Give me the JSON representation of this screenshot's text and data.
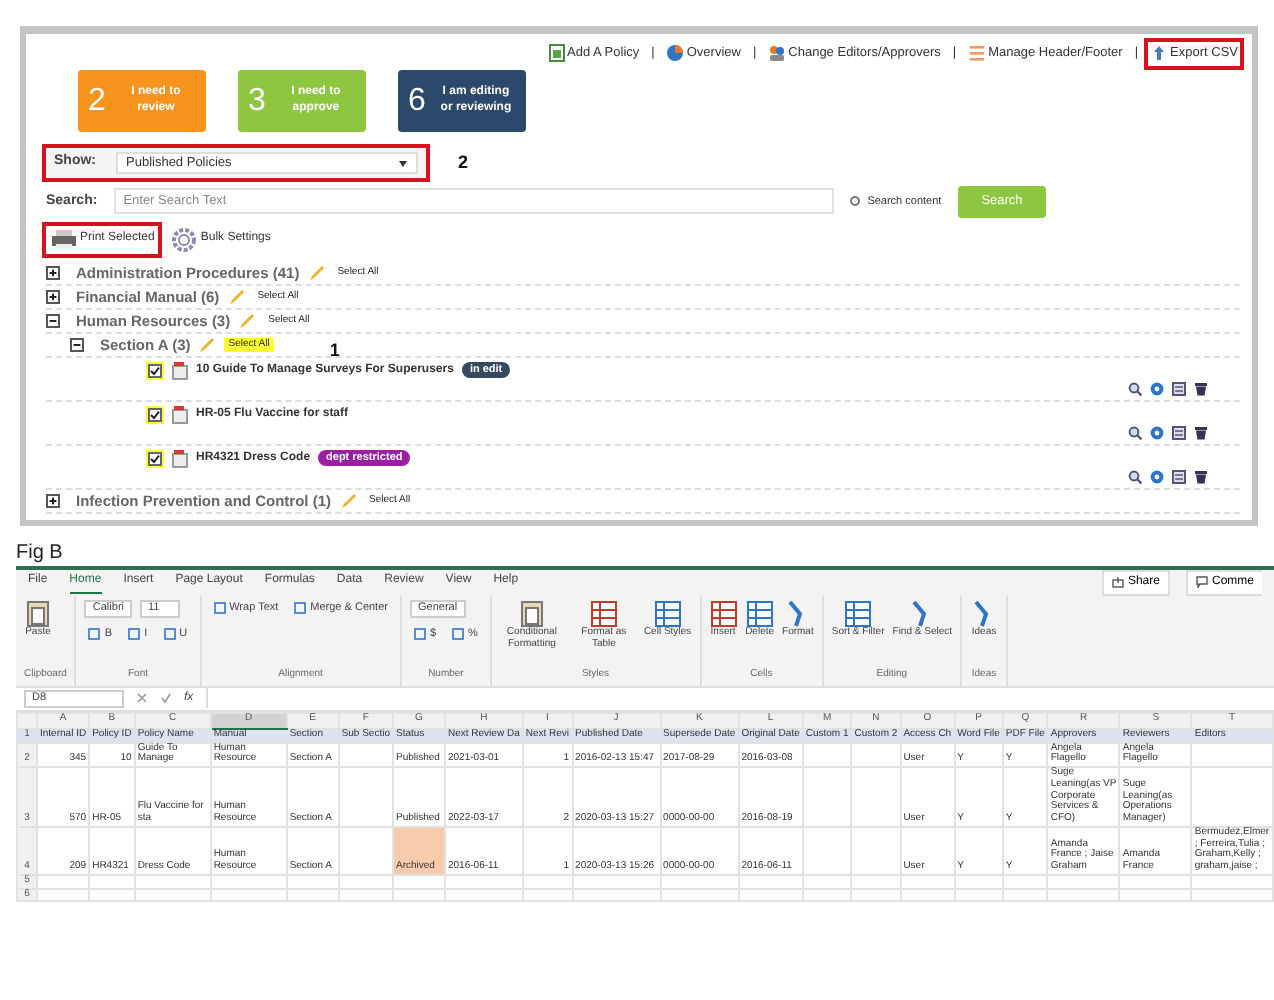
{
  "panel_a": {
    "tiles": [
      {
        "count": "2",
        "label": "I need to review",
        "color": "#f7941d"
      },
      {
        "count": "3",
        "label": "I need to approve",
        "color": "#8dc63f"
      },
      {
        "count": "6",
        "label": "I am editing or reviewing",
        "color": "#2b4a6b"
      }
    ],
    "top_links": [
      {
        "kind": "add",
        "label": "Add A Policy",
        "separator": "|",
        "highlighted": false
      },
      {
        "kind": "overview",
        "label": "Overview",
        "separator": "|",
        "highlighted": false
      },
      {
        "kind": "editors",
        "label": "Change Editors/Approvers",
        "separator": "|",
        "highlighted": false
      },
      {
        "kind": "header",
        "label": "Manage Header/Footer",
        "separator": "|",
        "highlighted": false
      },
      {
        "kind": "export",
        "label": "Export CSV",
        "highlighted": true
      }
    ],
    "show": {
      "label": "Show:",
      "value": "Published Policies",
      "highlighted": true,
      "callout": "2"
    },
    "search": {
      "label": "Search:",
      "placeholder": "Enter Search Text",
      "content_option": {
        "label": "Search content",
        "checked": false
      },
      "button": "Search"
    },
    "actions": [
      {
        "kind": "print",
        "label": "Print Selected",
        "highlighted": true
      },
      {
        "kind": "bulk",
        "label": "Bulk Settings",
        "highlighted": false
      }
    ],
    "tree": [
      {
        "label": "Administration Procedures (41)",
        "select_all": "Select All",
        "expanded": false,
        "highlighted": false
      },
      {
        "label": "Financial Manual (6)",
        "select_all": "Select All",
        "expanded": false,
        "highlighted": false
      },
      {
        "label": "Human Resources (3)",
        "select_all": "Select All",
        "expanded": true,
        "highlighted": false,
        "children": [
          {
            "label": "Section A (3)",
            "select_all": "Select All",
            "expanded": true,
            "highlighted": true,
            "callout": "1",
            "policies": [
              {
                "title": "10 Guide To Manage Surveys For Superusers",
                "checked": true,
                "highlighted": true,
                "badge": {
                  "text": "in edit",
                  "color": "#34495e"
                }
              },
              {
                "title": "HR-05 Flu Vaccine for staff",
                "checked": true,
                "highlighted": true
              },
              {
                "title": "HR4321 Dress Code",
                "checked": true,
                "highlighted": true,
                "badge": {
                  "text": "dept restricted",
                  "color": "#9b1fa3"
                }
              }
            ]
          }
        ]
      },
      {
        "label": "Infection Prevention and Control (1)",
        "select_all": "Select All",
        "expanded": false,
        "highlighted": false
      }
    ]
  },
  "fig_label": "Fig B",
  "excel": {
    "tabs": [
      {
        "label": "File",
        "selected": false
      },
      {
        "label": "Home",
        "selected": true
      },
      {
        "label": "Insert",
        "selected": false
      },
      {
        "label": "Page Layout",
        "selected": false
      },
      {
        "label": "Formulas",
        "selected": false
      },
      {
        "label": "Data",
        "selected": false
      },
      {
        "label": "Review",
        "selected": false
      },
      {
        "label": "View",
        "selected": false
      },
      {
        "label": "Help",
        "selected": false
      }
    ],
    "share": "Share",
    "comments": "Comme",
    "ribbon_groups": [
      {
        "label": "Clipboard",
        "kind": "large",
        "commands": [
          "Paste"
        ]
      },
      {
        "label": "Font",
        "kind": "small",
        "fields": [
          "Calibri",
          "11"
        ],
        "commands": [
          "B",
          "I",
          "U"
        ]
      },
      {
        "label": "Alignment",
        "kind": "small",
        "commands": [
          "Wrap Text",
          "Merge & Center"
        ]
      },
      {
        "label": "Number",
        "kind": "small",
        "fields": [
          "General"
        ],
        "commands": [
          "$",
          "%"
        ]
      },
      {
        "label": "Styles",
        "kind": "large",
        "commands": [
          "Conditional Formatting",
          "Format as Table",
          "Cell Styles"
        ]
      },
      {
        "label": "Cells",
        "kind": "large",
        "commands": [
          "Insert",
          "Delete",
          "Format"
        ]
      },
      {
        "label": "Editing",
        "kind": "large",
        "commands": [
          "Sort & Filter",
          "Find & Select"
        ]
      },
      {
        "label": "Ideas",
        "kind": "large",
        "commands": [
          "Ideas"
        ]
      }
    ],
    "formula_bar": {
      "name_box": "D8",
      "function_label": "fx"
    },
    "columns": [
      {
        "letter": "A",
        "selected": false
      },
      {
        "letter": "B",
        "selected": false
      },
      {
        "letter": "C",
        "selected": false
      },
      {
        "letter": "D",
        "selected": true
      },
      {
        "letter": "E",
        "selected": false
      },
      {
        "letter": "F",
        "selected": false
      },
      {
        "letter": "G",
        "selected": false
      },
      {
        "letter": "H",
        "selected": false
      },
      {
        "letter": "I",
        "selected": false
      },
      {
        "letter": "J",
        "selected": false
      },
      {
        "letter": "K",
        "selected": false
      },
      {
        "letter": "L",
        "selected": false
      },
      {
        "letter": "M",
        "selected": false
      },
      {
        "letter": "N",
        "selected": false
      },
      {
        "letter": "O",
        "selected": false
      },
      {
        "letter": "P",
        "selected": false
      },
      {
        "letter": "Q",
        "selected": false
      },
      {
        "letter": "R",
        "selected": false
      },
      {
        "letter": "S",
        "selected": false
      },
      {
        "letter": "T",
        "selected": false
      }
    ],
    "rows": [
      {
        "number": "1",
        "cells": [
          "Internal ID",
          "Policy ID",
          "Policy Name",
          "Manual",
          "Section",
          "Sub Sectio",
          "Status",
          "Next Review Da",
          "Next Revi",
          "Published Date",
          "Supersede Date",
          "Original Date",
          "Custom 1",
          "Custom 2",
          "Access Ch",
          "Word File",
          "PDF File",
          "Approvers",
          "Reviewers",
          "Editors"
        ]
      },
      {
        "number": "2",
        "cells": [
          "345",
          "10",
          "Guide To Manage",
          "Human Resource",
          "Section A",
          "",
          "Published",
          "2021-03-01",
          "1",
          "2016-02-13 15:47",
          "2017-08-29",
          "2016-03-08",
          "",
          "",
          "User",
          "Y",
          "Y",
          "Angela Flagello",
          "Angela Flagello",
          ""
        ]
      },
      {
        "number": "3",
        "cells": [
          "570",
          "HR-05",
          "Flu Vaccine for sta",
          "Human Resource",
          "Section A",
          "",
          "Published",
          "2022-03-17",
          "2",
          "2020-03-13 15:27",
          "0000-00-00",
          "2016-08-19",
          "",
          "",
          "User",
          "Y",
          "Y",
          "Suge Leaning(as VP Corporate Services & CFO)",
          "Suge Leaning(as Operations Manager)",
          ""
        ]
      },
      {
        "number": "4",
        "cells": [
          "209",
          "HR4321",
          "Dress Code",
          "Human Resource",
          "Section A",
          "",
          {
            "text": "Archived",
            "highlighted": true
          },
          "2016-06-11",
          "1",
          "2020-03-13 15:26",
          "0000-00-00",
          "2016-06-11",
          "",
          "",
          "User",
          "Y",
          "Y",
          "Amanda France ; Jaise Graham",
          "Amanda France",
          "Bermudez,Elmer ; Ferreira,Tulia ; Graham,Kelly ; graham,jaise ;"
        ]
      },
      {
        "number": "5",
        "cells": []
      },
      {
        "number": "6",
        "cells": []
      }
    ]
  }
}
